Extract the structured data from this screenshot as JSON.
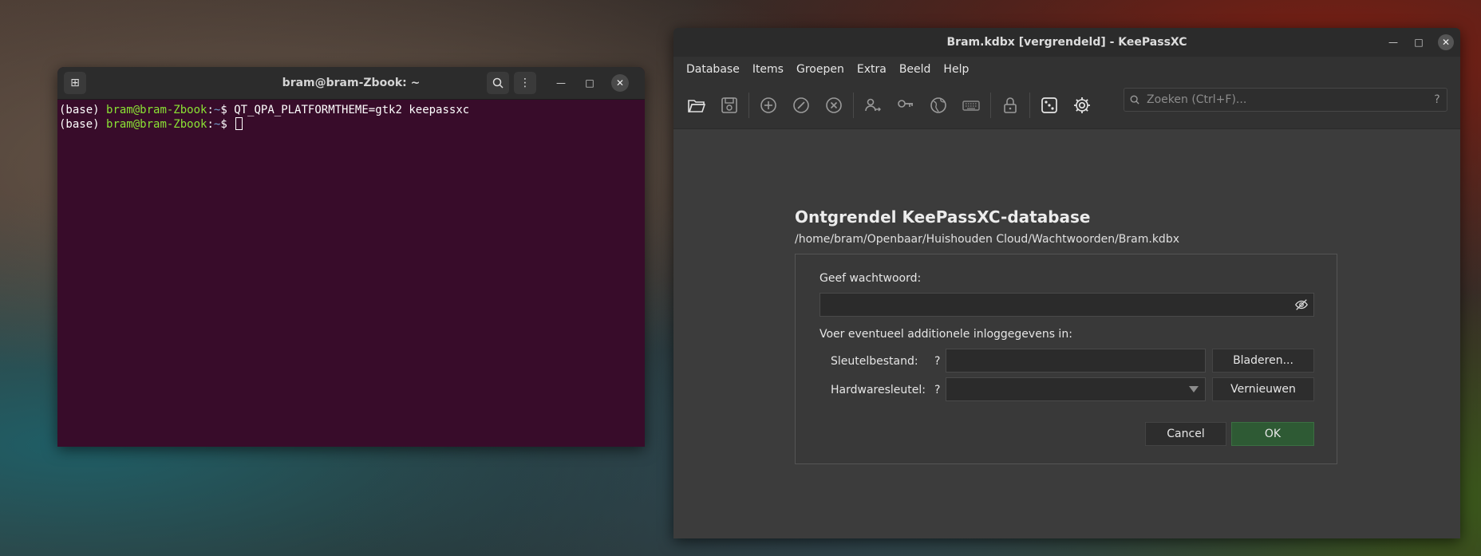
{
  "terminal": {
    "title": "bram@bram-Zbook: ~",
    "lines": [
      {
        "prefix": "(base) ",
        "user": "bram@bram-Zbook",
        "sep": ":",
        "path": "~",
        "dollar": "$ ",
        "command": "QT_QPA_PLATFORMTHEME=gtk2 keepassxc"
      },
      {
        "prefix": "(base) ",
        "user": "bram@bram-Zbook",
        "sep": ":",
        "path": "~",
        "dollar": "$ ",
        "command": ""
      }
    ]
  },
  "keepass": {
    "title": "Bram.kdbx [vergrendeld] - KeePassXC",
    "menu": [
      "Database",
      "Items",
      "Groepen",
      "Extra",
      "Beeld",
      "Help"
    ],
    "search": {
      "placeholder": "Zoeken (Ctrl+F)...",
      "help": "?"
    },
    "unlock": {
      "title": "Ontgrendel KeePassXC-database",
      "path": "/home/bram/Openbaar/Huishouden Cloud/Wachtwoorden/Bram.kdbx",
      "password_label": "Geef wachtwoord:",
      "additional_label": "Voer eventueel additionele inloggegevens in:",
      "keyfile_label": "Sleutelbestand:",
      "hardware_label": "Hardwaresleutel:",
      "help_mark": "?",
      "browse_button": "Bladeren...",
      "refresh_button": "Vernieuwen",
      "cancel_button": "Cancel",
      "ok_button": "OK"
    }
  },
  "icons": {
    "toolbar": [
      "folder-open-icon",
      "save-icon",
      "add-entry-icon",
      "edit-entry-icon",
      "delete-entry-icon",
      "transfer-user-icon",
      "key-icon",
      "globe-icon",
      "keyboard-icon",
      "lock-icon",
      "dice-icon",
      "gear-icon"
    ]
  },
  "colors": {
    "terminal_bg": "#380c2a",
    "prompt_user": "#8ae234",
    "prompt_path": "#729fcf",
    "ok_button": "#2e5a34"
  }
}
